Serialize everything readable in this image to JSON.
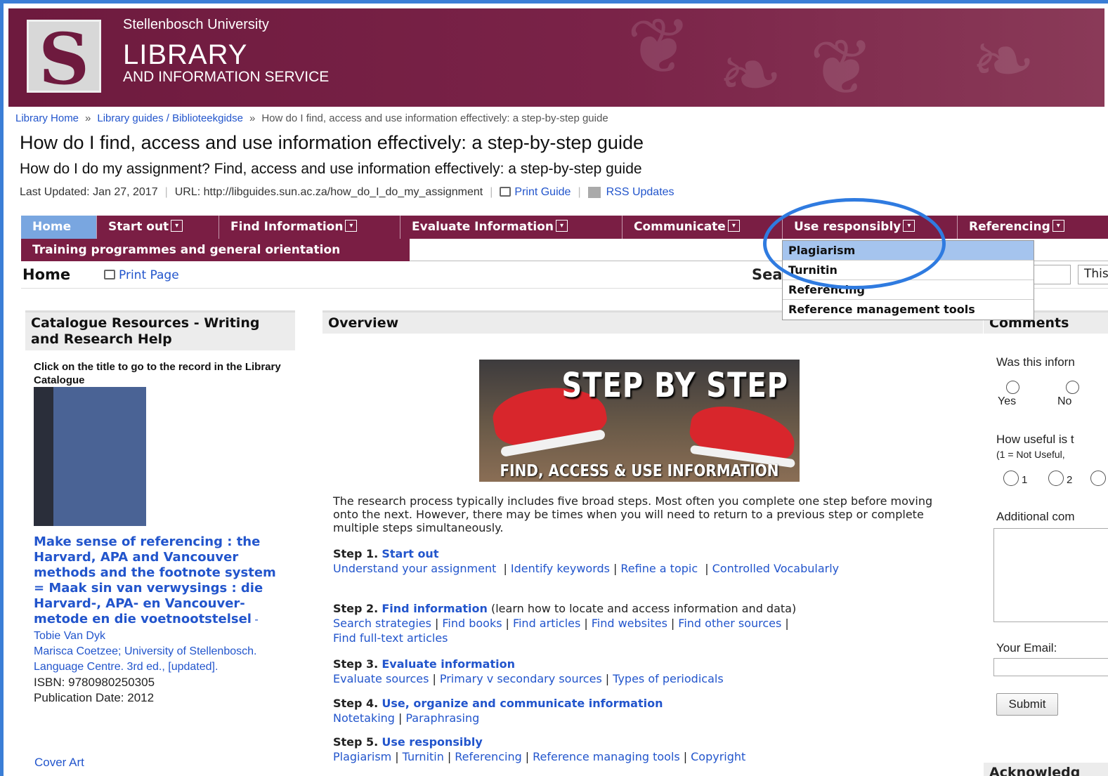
{
  "header": {
    "university": "Stellenbosch University",
    "library": "LIBRARY",
    "service": "AND INFORMATION SERVICE"
  },
  "breadcrumb": {
    "items": [
      "Library Home",
      "Library guides / Biblioteekgidse"
    ],
    "current": "How do I find, access and use information effectively: a step-by-step guide",
    "separator": "»"
  },
  "page": {
    "title": "How do I find, access and use information effectively: a step-by-step guide",
    "subtitle": "How do I do my assignment? Find, access and use information effectively: a step-by-step guide",
    "last_updated": "Last Updated: Jan 27, 2017",
    "url": "URL: http://libguides.sun.ac.za/how_do_I_do_my_assignment",
    "print_guide": "Print Guide",
    "rss": "RSS Updates"
  },
  "tabs": [
    {
      "label": "Home",
      "active": true
    },
    {
      "label": "Start out"
    },
    {
      "label": "Find Information"
    },
    {
      "label": "Evaluate Information"
    },
    {
      "label": "Communicate"
    },
    {
      "label": "Use responsibly"
    },
    {
      "label": "Referencing"
    },
    {
      "label": "Training programmes and general orientation"
    }
  ],
  "dropdown": {
    "items": [
      "Plagiarism",
      "Turnitin",
      "Referencing",
      "Reference management tools"
    ],
    "highlighted": "Plagiarism"
  },
  "subbar": {
    "home": "Home",
    "print_page": "Print Page",
    "search_label": "Sea",
    "search_scope": "This"
  },
  "left": {
    "heading": "Catalogue Resources - Writing and Research Help",
    "intro": "Click on the title to go to the record in the Library Catalogue",
    "book_title": "Make sense of referencing : the Harvard, APA and Vancouver methods and the footnote system = Maak sin van verwysings : die Harvard-, APA- en Vancouver-metode en die voetnootstelsel",
    "book_author": " - Tobie Van Dyk",
    "book_details": "Marisca Coetzee; University of Stellenbosch. Language Centre. 3rd ed., [updated].",
    "isbn": "ISBN: 9780980250305",
    "pub_date": "Publication Date: 2012",
    "cover_art": "Cover Art"
  },
  "middle": {
    "heading": "Overview",
    "hero_title": "STEP BY STEP",
    "hero_sub": "FIND, ACCESS & USE INFORMATION",
    "overview": "The research process typically includes five broad steps. Most often you complete one step before moving onto the next. However, there may be times when you will need to return to a previous step or complete multiple steps simultaneously.",
    "steps": [
      {
        "label": "Step 1.",
        "link": "Start out",
        "extra": "",
        "links": [
          "Understand your assignment",
          "Identify keywords",
          "Refine a topic",
          "Controlled Vocabularly"
        ]
      },
      {
        "label": "Step 2.",
        "link": "Find information",
        "extra": " (learn how to locate and access information and data)",
        "links": [
          "Search strategies",
          "Find books",
          "Find articles",
          "Find websites",
          "Find other sources",
          "Find full-text articles"
        ]
      },
      {
        "label": "Step 3.",
        "link": "Evaluate information",
        "extra": "",
        "links": [
          "Evaluate sources",
          "Primary v secondary sources",
          "Types of periodicals"
        ]
      },
      {
        "label": "Step 4.",
        "link": "Use, organize and communicate information",
        "extra": "",
        "links": [
          "Notetaking",
          "Paraphrasing"
        ]
      },
      {
        "label": "Step 5.",
        "link": "Use responsibly",
        "extra": "",
        "links": [
          "Plagiarism",
          "Turnitin",
          "Referencing",
          "Reference managing tools",
          "Copyright"
        ]
      }
    ]
  },
  "right": {
    "heading": "Comments",
    "question1": "Was this inforn",
    "yes": "Yes",
    "no": "No",
    "question2": "How useful is t",
    "scale": "(1 = Not Useful,",
    "opt1": "1",
    "opt2": "2",
    "additional": "Additional com",
    "email": "Your Email:",
    "submit": "Submit",
    "ack": "Acknowledg"
  },
  "colors": {
    "brand": "#7a1e44",
    "active_tab": "#79a6e0",
    "link": "#2255cc",
    "highlight_ring": "#2f7be0"
  }
}
